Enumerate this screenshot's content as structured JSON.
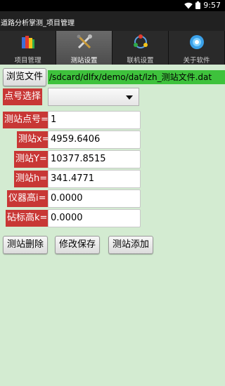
{
  "status_bar": {
    "time": "9:57"
  },
  "title_bar": {
    "title": "道路分析掌测_项目管理"
  },
  "tabs": [
    {
      "label": "项目管理",
      "icon": "books-icon",
      "active": false
    },
    {
      "label": "测站设置",
      "icon": "tools-icon",
      "active": true
    },
    {
      "label": "联机设置",
      "icon": "network-icon",
      "active": false
    },
    {
      "label": "关于软件",
      "icon": "globe-icon",
      "active": false
    }
  ],
  "browse": {
    "button_label": "浏览文件",
    "path": "/sdcard/dlfx/demo/dat/lzh_测站文件.dat"
  },
  "point_select": {
    "label": "点号选择",
    "value": ""
  },
  "fields": [
    {
      "label": "测站点号=",
      "value": "1"
    },
    {
      "label": "测站x=",
      "value": "4959.6406"
    },
    {
      "label": "测站Y=",
      "value": "10377.8515"
    },
    {
      "label": "测站h=",
      "value": "341.4771"
    },
    {
      "label": "仪器高i=",
      "value": "0.0000"
    },
    {
      "label": "砧标高k=",
      "value": "0.0000"
    }
  ],
  "actions": {
    "delete_label": "测站删除",
    "save_label": "修改保存",
    "add_label": "测站添加"
  },
  "colors": {
    "accent_green": "#3ec23c",
    "label_red": "#c83735",
    "background": "#d3ebd1"
  }
}
